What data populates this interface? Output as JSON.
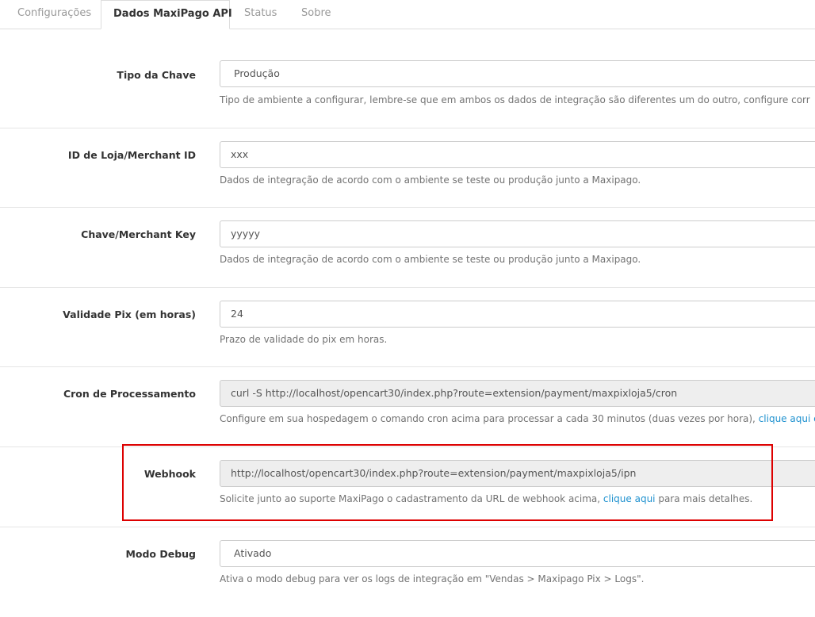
{
  "tabs": [
    {
      "label": "Configurações",
      "active": false
    },
    {
      "label": "Dados MaxiPago API",
      "active": true
    },
    {
      "label": "Status",
      "active": false
    },
    {
      "label": "Sobre",
      "active": false
    }
  ],
  "fields": {
    "tipo_chave": {
      "label": "Tipo da Chave",
      "value": "Produção",
      "help": "Tipo de ambiente a configurar, lembre-se que em ambos os dados de integração são diferentes um do outro, configure corr"
    },
    "merchant_id": {
      "label": "ID de Loja/Merchant ID",
      "value": "xxx",
      "help": "Dados de integração de acordo com o ambiente se teste ou produção junto a Maxipago."
    },
    "merchant_key": {
      "label": "Chave/Merchant Key",
      "value": "yyyyy",
      "help": "Dados de integração de acordo com o ambiente se teste ou produção junto a Maxipago."
    },
    "validade_pix": {
      "label": "Validade Pix (em horas)",
      "value": "24",
      "help": "Prazo de validade do pix em horas."
    },
    "cron": {
      "label": "Cron de Processamento",
      "value": "curl -S http://localhost/opencart30/index.php?route=extension/payment/maxpixloja5/cron",
      "help_before": "Configure em sua hospedagem o comando cron acima para processar a cada 30 minutos (duas vezes por hora), ",
      "help_link": "clique aqui e"
    },
    "webhook": {
      "label": "Webhook",
      "value": "http://localhost/opencart30/index.php?route=extension/payment/maxpixloja5/ipn",
      "help_before": "Solicite junto ao suporte MaxiPago o cadastramento da URL de webhook acima, ",
      "help_link": "clique aqui",
      "help_after": " para mais detalhes."
    },
    "modo_debug": {
      "label": "Modo Debug",
      "value": "Ativado",
      "help": "Ativa o modo debug para ver os logs de integração em \"Vendas > Maxipago Pix > Logs\"."
    }
  },
  "colors": {
    "highlight": "#dd0000",
    "link": "#1e91cf"
  }
}
